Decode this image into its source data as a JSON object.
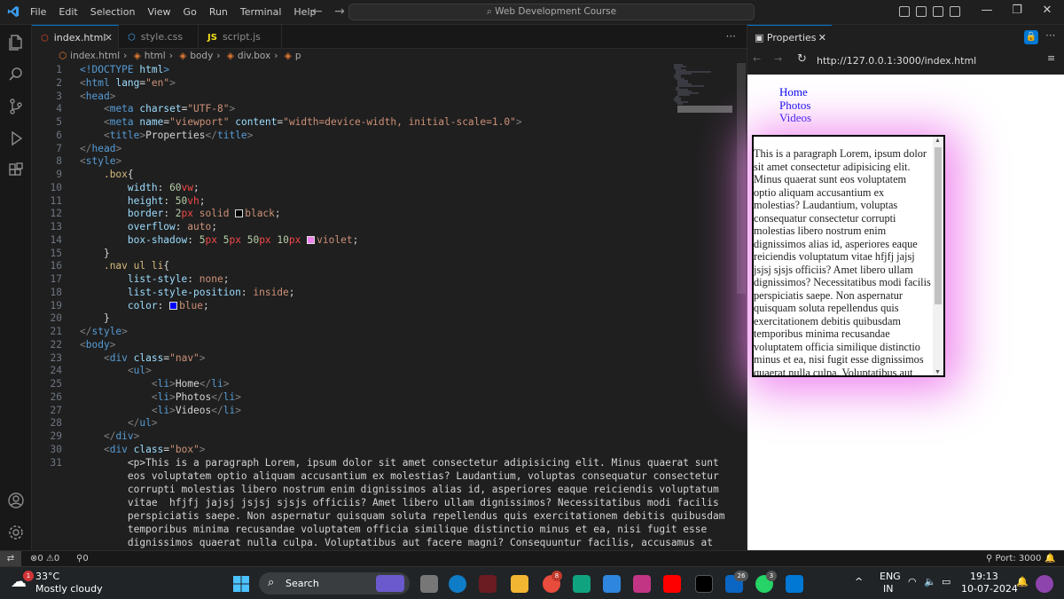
{
  "titlebar": {
    "menu": [
      "File",
      "Edit",
      "Selection",
      "View",
      "Go",
      "Run",
      "Terminal",
      "Help"
    ],
    "search_text": "Web Development Course"
  },
  "tabs": [
    {
      "label": "index.html",
      "icon": "html5-icon",
      "active": true
    },
    {
      "label": "style.css",
      "icon": "css-icon",
      "active": false
    },
    {
      "label": "script.js",
      "icon": "js-icon",
      "active": false
    }
  ],
  "breadcrumb": [
    "index.html",
    "html",
    "body",
    "div.box",
    "p"
  ],
  "code": {
    "line_numbers": [
      "1",
      "2",
      "3",
      "4",
      "5",
      "6",
      "7",
      "8",
      "9",
      "10",
      "11",
      "12",
      "13",
      "14",
      "15",
      "16",
      "17",
      "18",
      "19",
      "20",
      "21",
      "22",
      "23",
      "24",
      "25",
      "26",
      "27",
      "28",
      "29",
      "30",
      "31"
    ],
    "p_lines": [
      "<p>This is a paragraph Lorem, ipsum dolor sit amet consectetur adipisicing elit. Minus quaerat sunt",
      "eos voluptatem optio aliquam accusantium ex molestias? Laudantium, voluptas consequatur consectetur",
      "corrupti molestias libero nostrum enim dignissimos alias id, asperiores eaque reiciendis voluptatum",
      "vitae  hfjfj jajsj jsjsj sjsjs officiis? Amet libero ullam dignissimos? Necessitatibus modi facilis",
      "perspiciatis saepe. Non aspernatur quisquam soluta repellendus quis exercitationem debitis quibusdam",
      "temporibus minima recusandae voluptatem officia similique distinctio minus et ea, nisi fugit esse",
      "dignissimos quaerat nulla culpa. Voluptatibus aut facere magni? Consequuntur facilis, accusamus at"
    ]
  },
  "preview": {
    "tab_label": "Properties",
    "url": "http://127.0.0.1:3000/index.html",
    "nav_items": [
      "Home",
      "Photos",
      "Videos"
    ],
    "paragraph": "This is a paragraph Lorem, ipsum dolor sit amet consectetur adipisicing elit. Minus quaerat sunt eos voluptatem optio aliquam accusantium ex molestias? Laudantium, voluptas consequatur consectetur corrupti molestias libero nostrum enim dignissimos alias id, asperiores eaque reiciendis voluptatum vitae hfjfj jajsj jsjsj sjsjs officiis? Amet libero ullam dignissimos? Necessitatibus modi facilis perspiciatis saepe. Non aspernatur quisquam soluta repellendus quis exercitationem debitis quibusdam temporibus minima recusandae voluptatem officia similique distinctio minus et ea, nisi fugit esse dignissimos quaerat nulla culpa. Voluptatibus aut"
  },
  "status": {
    "errors": "0",
    "warnings": "0",
    "ports": "0",
    "port_label": "Port: 3000"
  },
  "taskbar": {
    "weather_temp": "33°C",
    "weather_desc": "Mostly cloudy",
    "search_label": "Search",
    "lang": "ENG",
    "region": "IN",
    "time": "19:13",
    "date": "10-07-2024",
    "badges": {
      "chrome": "8",
      "linkedin": "26",
      "whatsapp": "3",
      "weather": "1"
    }
  },
  "colors": {
    "accent": "#0078d4",
    "shadow": "violet",
    "nav_link": "#0000ee"
  }
}
